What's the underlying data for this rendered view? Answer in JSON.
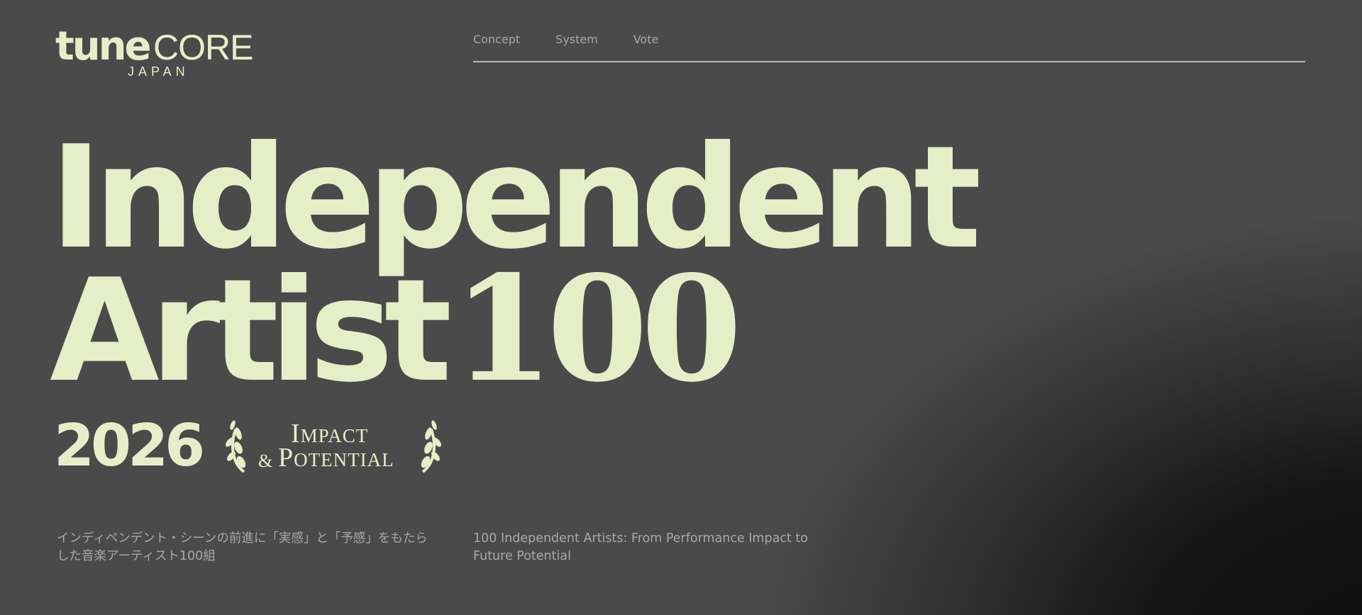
{
  "colors": {
    "background": "#4a4a4a",
    "accent": "#e6eec8",
    "muted_text": "#a8a8a4"
  },
  "logo": {
    "word_light": "tune",
    "word_caps": "CORE",
    "sub": "JAPAN"
  },
  "nav": {
    "items": [
      {
        "label": "Concept"
      },
      {
        "label": "System"
      },
      {
        "label": "Vote"
      }
    ]
  },
  "hero": {
    "line1": "Independent",
    "line2_word": "Artist",
    "line2_number": "100",
    "year": "2026",
    "badge": {
      "line1": "Impact",
      "ampersand": "&",
      "line2": "Potential"
    }
  },
  "description": {
    "ja": "インディペンデント・シーンの前進に「実感」と「予感」をもたらした音楽アーティスト100組",
    "en": "100 Independent Artists: From Performance Impact to Future Potential"
  }
}
